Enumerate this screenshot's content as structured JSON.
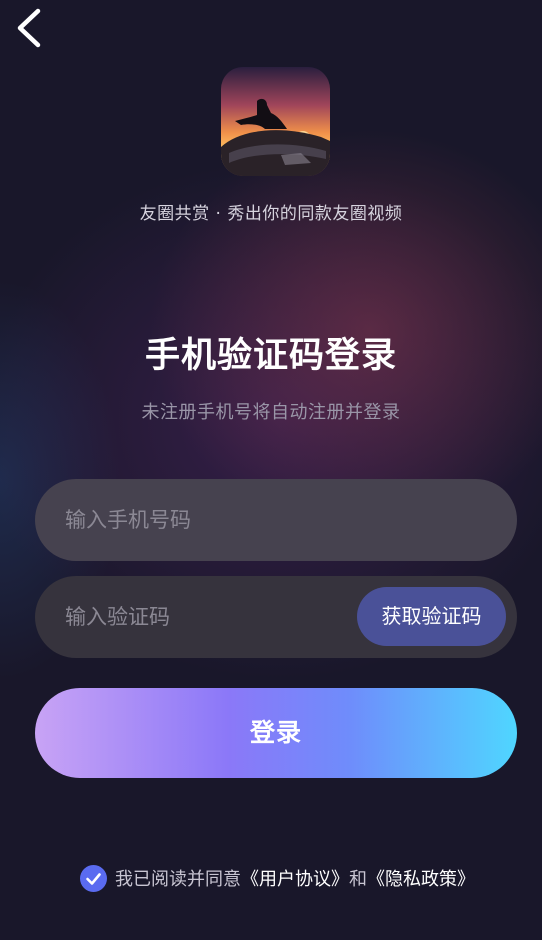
{
  "header": {
    "back_icon": "chevron-left-icon"
  },
  "brand": {
    "logo_icon": "app-logo-image",
    "tagline": "友圈共赏 · 秀出你的同款友圈视频"
  },
  "login": {
    "title": "手机验证码登录",
    "subtitle": "未注册手机号将自动注册并登录",
    "phone_input": {
      "value": "",
      "placeholder": "输入手机号码"
    },
    "code_input": {
      "value": "",
      "placeholder": "输入验证码"
    },
    "get_code_label": "获取验证码",
    "submit_label": "登录"
  },
  "agreement": {
    "checked": true,
    "check_icon": "checkmark-icon",
    "prefix": "我已阅读并同意",
    "user_agreement": "《用户协议》",
    "conjunction": "和",
    "privacy_policy": "《隐私政策》"
  },
  "colors": {
    "background": "#19172a",
    "phone_field_bg": "#46424f",
    "code_field_bg": "#36333d",
    "get_code_bg": "#4a5198",
    "login_gradient_start": "#c8a3f5",
    "login_gradient_end": "#4fd6ff",
    "check_bg": "#5a6bf0"
  }
}
